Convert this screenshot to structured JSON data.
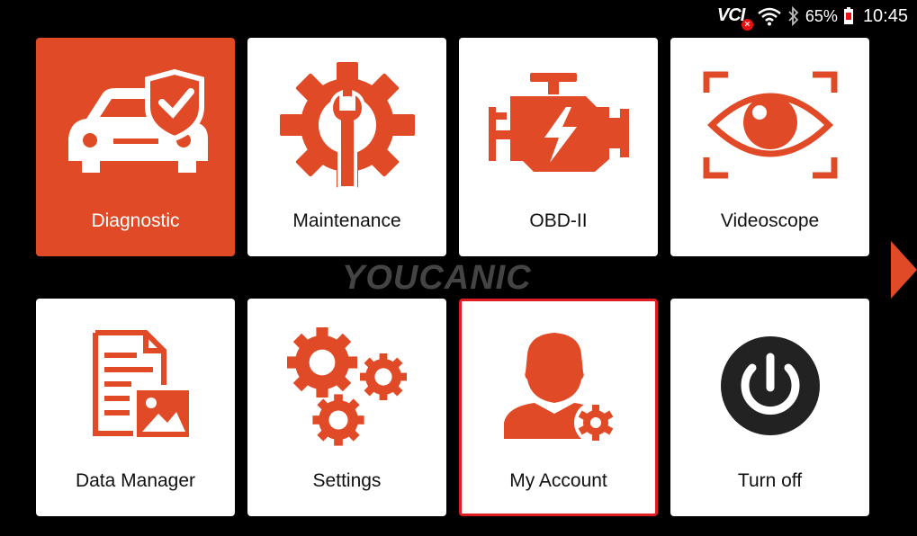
{
  "statusbar": {
    "vci_label": "VCI",
    "battery_percent": "65%",
    "time": "10:45",
    "icons": [
      "vci-disconnected-icon",
      "wifi-icon",
      "bluetooth-icon",
      "battery-icon"
    ]
  },
  "watermark": "YOUCANIC",
  "colors": {
    "accent": "#e14a26",
    "selected_border": "#e11d24",
    "background": "#000000",
    "tile": "#ffffff"
  },
  "tiles": [
    {
      "label": "Diagnostic",
      "icon": "car-shield-icon",
      "active": true
    },
    {
      "label": "Maintenance",
      "icon": "gear-wrench-icon"
    },
    {
      "label": "OBD-II",
      "icon": "engine-icon"
    },
    {
      "label": "Videoscope",
      "icon": "eye-icon"
    },
    {
      "label": "Data Manager",
      "icon": "document-image-icon"
    },
    {
      "label": "Settings",
      "icon": "gears-icon"
    },
    {
      "label": "My Account",
      "icon": "user-gear-icon",
      "selected": true
    },
    {
      "label": "Turn off",
      "icon": "power-icon"
    }
  ],
  "navigation": {
    "next_page_icon": "arrow-right-icon"
  }
}
